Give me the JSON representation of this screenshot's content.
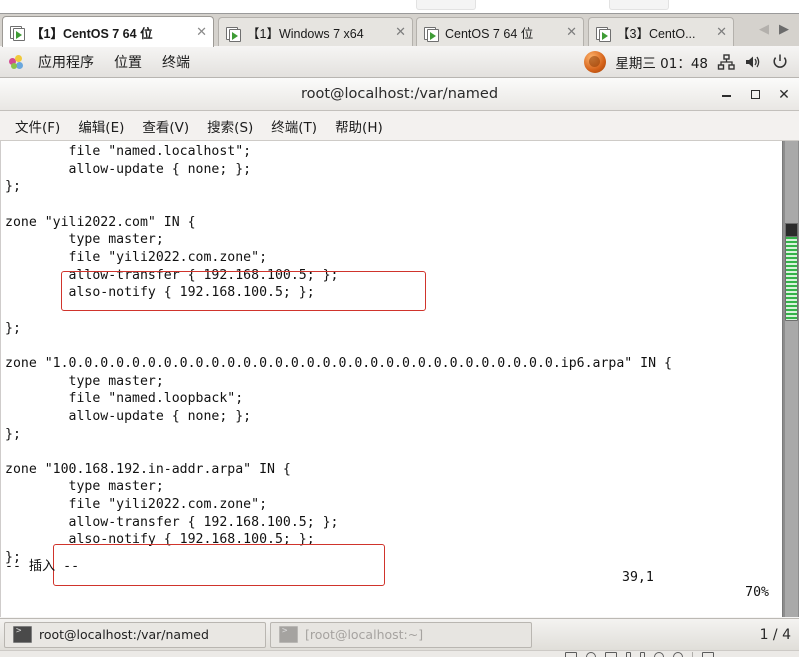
{
  "vmware": {
    "tabs": [
      {
        "label": "【1】CentOS 7 64 位",
        "active": true,
        "close": "✕"
      },
      {
        "label": "【1】Windows 7 x64",
        "active": false,
        "close": "✕"
      },
      {
        "label": "CentOS 7 64 位",
        "active": false,
        "close": "✕"
      },
      {
        "label": "【3】CentO...",
        "active": false,
        "close": "✕"
      }
    ],
    "nav_prev": "◀",
    "nav_next": "▶"
  },
  "gnome_panel": {
    "menus": [
      "应用程序",
      "位置",
      "终端"
    ],
    "clock": "星期三 01：48",
    "tray": [
      "network-icon",
      "volume-icon",
      "power-icon"
    ]
  },
  "terminal": {
    "title": "root@localhost:/var/named",
    "window_buttons": {
      "minimize": "minimize-icon",
      "maximize": "maximize-icon",
      "close": "✕"
    },
    "menus": [
      "文件(F)",
      "编辑(E)",
      "查看(V)",
      "搜索(S)",
      "终端(T)",
      "帮助(H)"
    ],
    "content_lines": [
      "        file \"named.localhost\";",
      "        allow-update { none; };",
      "};",
      "",
      "zone \"yili2022.com\" IN {",
      "        type master;",
      "        file \"yili2022.com.zone\";",
      "        allow-transfer { 192.168.100.5; };",
      "        also-notify { 192.168.100.5; };",
      "",
      "};",
      "",
      "zone \"1.0.0.0.0.0.0.0.0.0.0.0.0.0.0.0.0.0.0.0.0.0.0.0.0.0.0.0.0.0.0.0.ip6.arpa\" IN {",
      "        type master;",
      "        file \"named.loopback\";",
      "        allow-update { none; };",
      "};",
      "",
      "zone \"100.168.192.in-addr.arpa\" IN {",
      "        type master;",
      "        file \"yili2022.com.zone\";",
      "        allow-transfer { 192.168.100.5; };",
      "        also-notify { 192.168.100.5; };",
      "};"
    ],
    "status": {
      "mode": "-- 插入 --",
      "position": "39,1",
      "percent": "70%"
    },
    "annotations": [
      {
        "name": "also-notify-highlight-forward-zone"
      },
      {
        "name": "also-notify-highlight-reverse-zone"
      }
    ]
  },
  "taskbar": {
    "items": [
      {
        "label": "root@localhost:/var/named",
        "active": true
      },
      {
        "label": "[root@localhost:~]",
        "active": false
      }
    ],
    "pager": "1 / 4"
  }
}
